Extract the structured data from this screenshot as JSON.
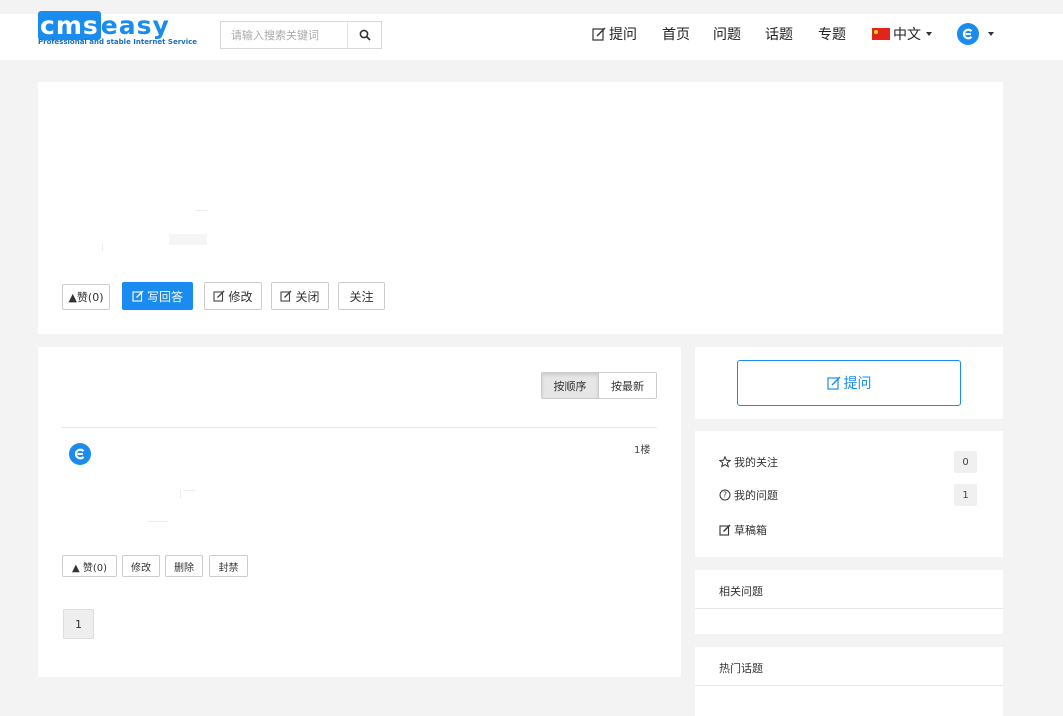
{
  "header": {
    "logo_text_cms": "cms",
    "logo_text_easy": "easy",
    "logo_tagline": "Professional and stable Internet Service",
    "search_placeholder": "请输入搜索关键词",
    "nav": {
      "ask": "提问",
      "home": "首页",
      "questions": "问题",
      "topics": "话题",
      "specials": "专题",
      "language": "中文"
    }
  },
  "question": {
    "like_label": "▲赞(0)",
    "answer_label": "写回答",
    "edit_label": "修改",
    "close_label": "关闭",
    "follow_label": "关注"
  },
  "answers": {
    "sort_order_label": "按顺序",
    "sort_newest_label": "按最新",
    "floor_label": "1楼",
    "like_label": "▲ 赞(0)",
    "edit_label": "修改",
    "delete_label": "删除",
    "ban_label": "封禁",
    "page": "1"
  },
  "sidebar": {
    "ask_button_label": "提问",
    "my_follows_label": "我的关注",
    "my_follows_count": "0",
    "my_questions_label": "我的问题",
    "my_questions_count": "1",
    "drafts_label": "草稿箱",
    "related_title": "相关问题",
    "hot_topics_title": "热门话题"
  },
  "colors": {
    "brand": "#1a8cf0",
    "background": "#f3f3f3"
  }
}
